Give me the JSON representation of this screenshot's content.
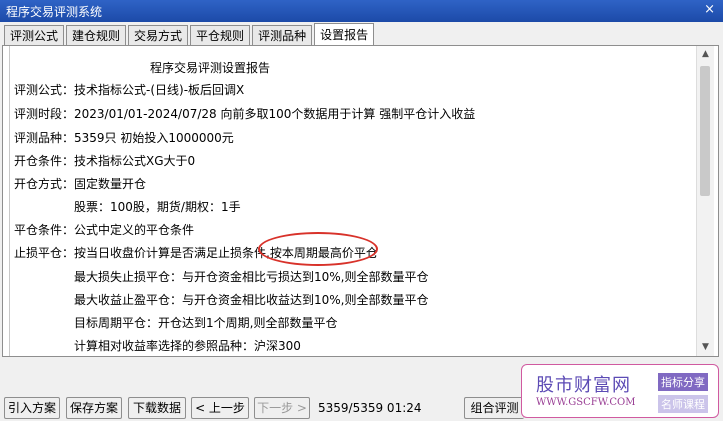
{
  "window": {
    "title": "程序交易评测系统",
    "close": "×"
  },
  "tabs": [
    {
      "label": "评测公式",
      "active": false
    },
    {
      "label": "建仓规则",
      "active": false
    },
    {
      "label": "交易方式",
      "active": false
    },
    {
      "label": "平仓规则",
      "active": false
    },
    {
      "label": "评测品种",
      "active": false
    },
    {
      "label": "设置报告",
      "active": true
    }
  ],
  "report": {
    "heading": "程序交易评测设置报告",
    "lines": [
      "评测公式：技术指标公式-(日线)-板后回调X",
      "评测时段：2023/01/01-2024/07/28 向前多取100个数据用于计算 强制平仓计入收益",
      "评测品种：5359只 初始投入1000000元",
      "开仓条件：技术指标公式XG大于0",
      "开仓方式：固定数量开仓",
      "股票：100股，期货/期权：1手",
      "平仓条件：公式中定义的平仓条件",
      "止损平仓：按当日收盘价计算是否满足止损条件,按本周期最高价平仓",
      "最大损失止损平仓：与开仓资金相比亏损达到10%,则全部数量平仓",
      "最大收益止盈平仓：与开仓资金相比收益达到10%,则全部数量平仓",
      "目标周期平仓：开仓达到1个周期,则全部数量平仓",
      "计算相对收益率选择的参照品种：沪深300"
    ]
  },
  "buttons": {
    "import": "引入方案",
    "save": "保存方案",
    "download": "下载数据",
    "prev": "< 上一步",
    "next": "下一步 >",
    "combo": "组合评测"
  },
  "status": "5359/5359 01:24",
  "watermark": {
    "main": "股市财富网",
    "url": "WWW.GSCFW.COM",
    "badge1": "指标分享",
    "badge2": "名师课程"
  },
  "colors": {
    "titlebar": "#1c4aa8",
    "highlight_ellipse": "#d8322a",
    "watermark": "#5c4bb5"
  }
}
